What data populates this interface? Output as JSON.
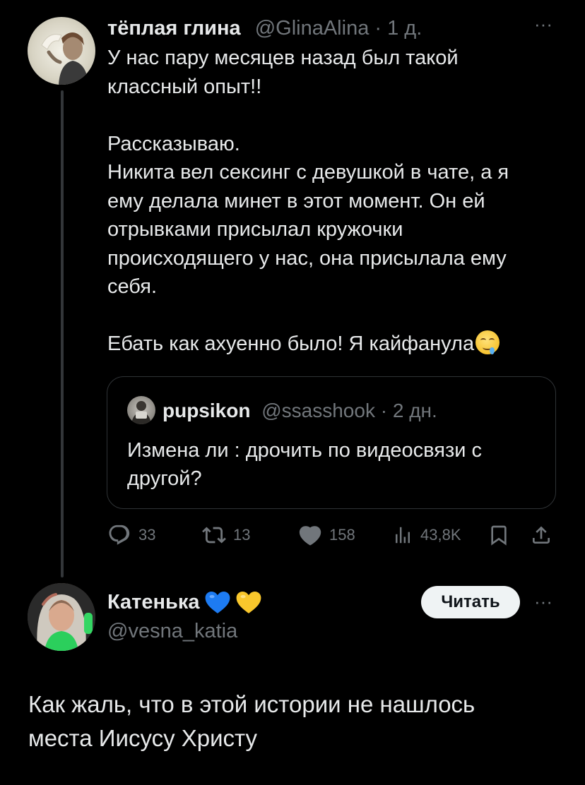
{
  "tweet": {
    "author": {
      "display_name": "тёплая глина",
      "handle": "@GlinaAlina",
      "age": "· 1 д."
    },
    "body": "У нас пару месяцев назад был такой\nклассный опыт!!\n\nРассказываю.\nНикита вел сексинг с девушкой в чате, а я\nему делала минет в этот момент. Он ей\nотрывками присылал кружочки\nпроисходящего у нас, она присылала ему\nсебя.\n\nЕбать как ахуенно было! Я кайфанула",
    "trailing_emoji": "drooling-face-emoji",
    "more_icon": "more-dots-icon",
    "quote": {
      "display_name": "pupsikon",
      "handle": "@ssasshook",
      "age": "· 2 дн.",
      "body": "Измена ли : дрочить по видеосвязи с\nдругой?"
    },
    "actions": {
      "replies": "33",
      "retweets": "13",
      "likes": "158",
      "views": "43,8K",
      "icons": [
        "reply-icon",
        "retweet-icon",
        "like-icon",
        "views-icon",
        "bookmark-icon",
        "share-icon"
      ]
    }
  },
  "reply": {
    "display_name": "Катенька",
    "name_emojis": [
      "blue-heart-emoji",
      "yellow-heart-emoji"
    ],
    "handle": "@vesna_katia",
    "follow_label": "Читать",
    "body": "Как жаль, что в этой истории не нашлось\nместа Иисусу Христу"
  },
  "colors": {
    "background": "#000000",
    "text": "#e7e9ea",
    "muted": "#71767b",
    "border": "#2f3336",
    "follow_button_bg": "#eff3f4",
    "blue_heart": "#1d7bf2",
    "yellow_heart": "#f9c72c"
  }
}
